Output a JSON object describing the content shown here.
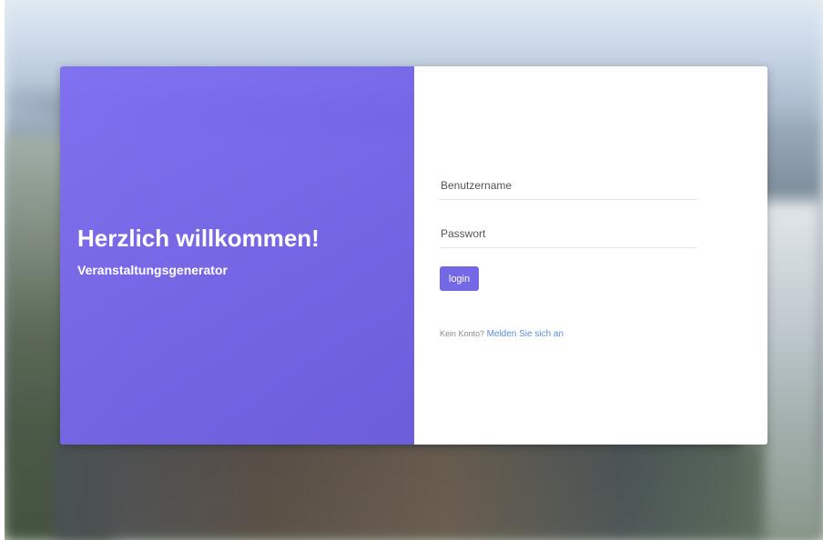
{
  "welcome": {
    "title": "Herzlich willkommen!",
    "subtitle": "Veranstaltungsgenerator"
  },
  "form": {
    "username_placeholder": "Benutzername",
    "username_value": "",
    "password_placeholder": "Passwort",
    "password_value": "",
    "login_label": "login",
    "no_account_text": "Kein Konto?",
    "signup_link_label": "Melden Sie sich an"
  },
  "colors": {
    "accent": "#7468e6",
    "welcome_panel": "#7a6cee",
    "link": "#5b8fd6"
  }
}
